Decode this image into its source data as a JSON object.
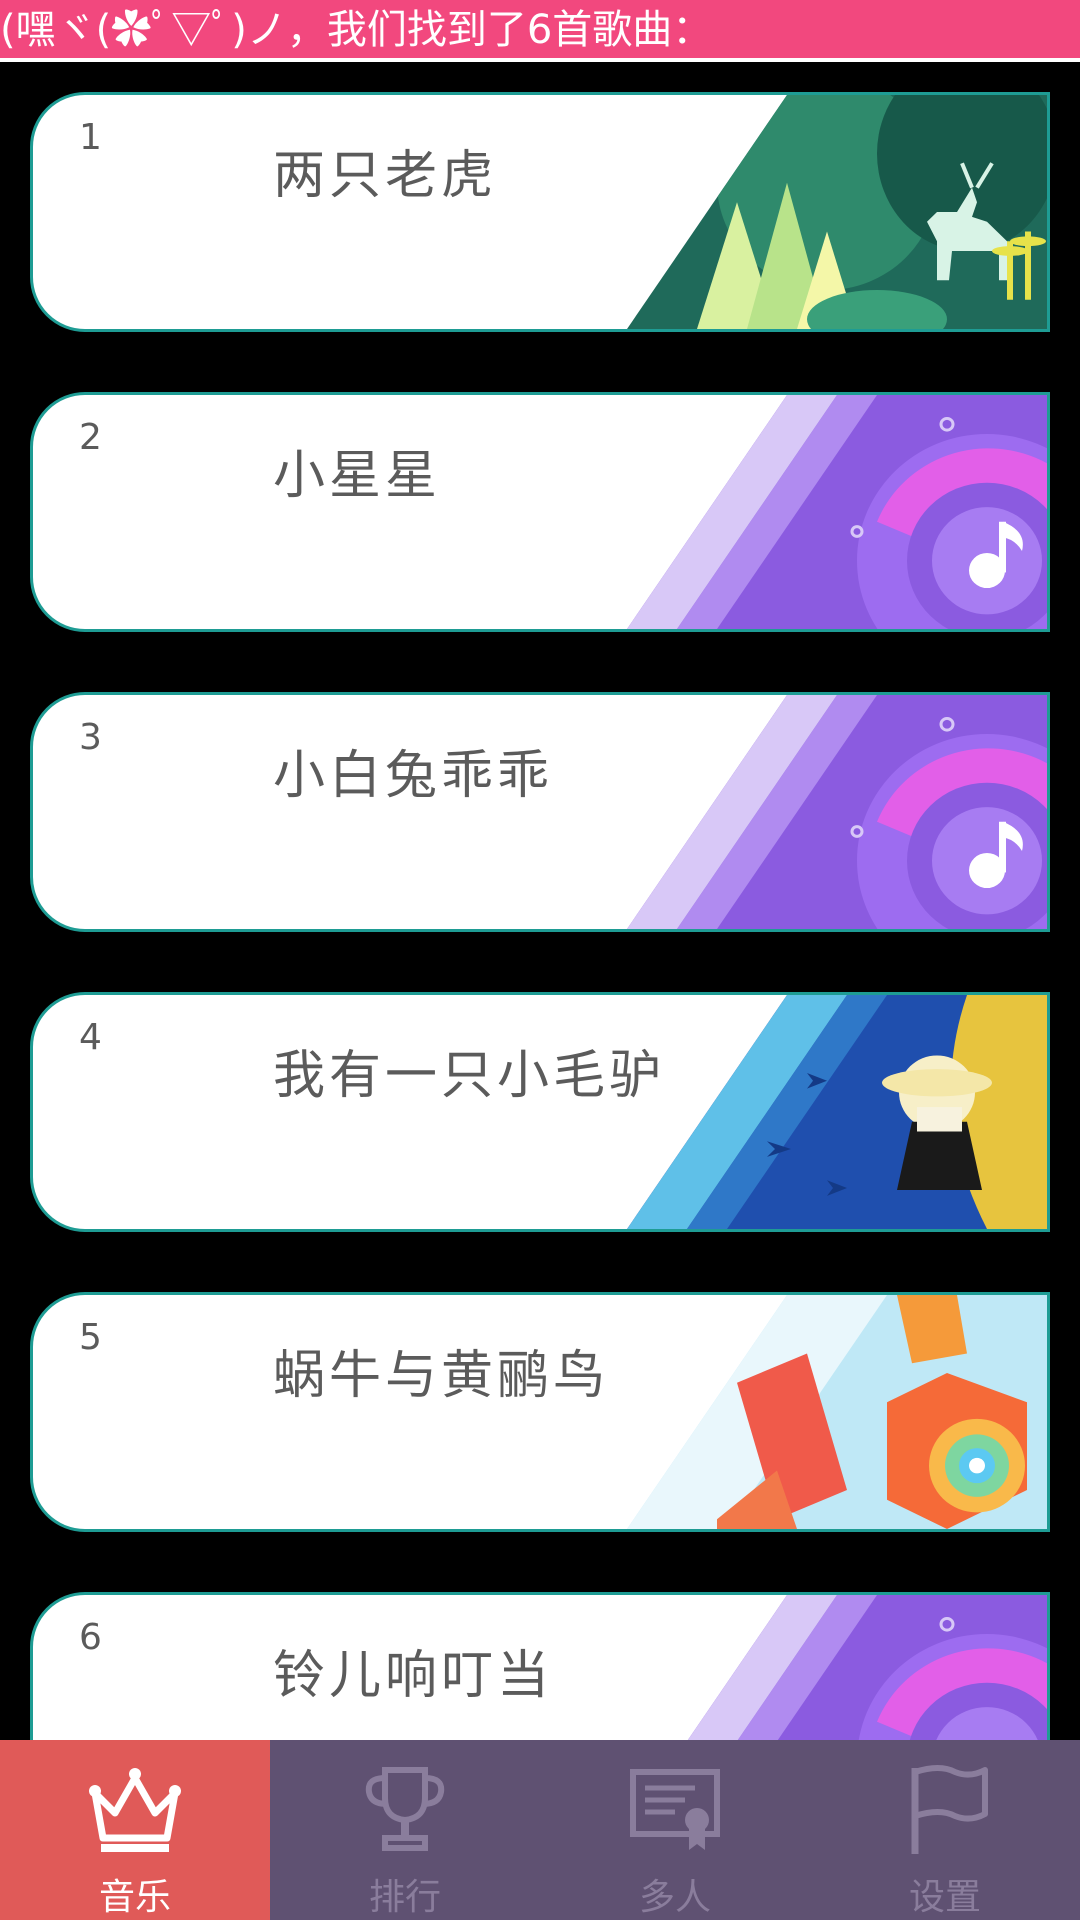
{
  "header": {
    "message": "(嘿ヾ(✿ﾟ▽ﾟ)ノ，我们找到了6首歌曲："
  },
  "songs": [
    {
      "number": "1",
      "title": "两只老虎",
      "art": "forest-deer-art"
    },
    {
      "number": "2",
      "title": "小星星",
      "art": "purple-music-art"
    },
    {
      "number": "3",
      "title": "小白兔乖乖",
      "art": "purple-music-art"
    },
    {
      "number": "4",
      "title": "我有一只小毛驴",
      "art": "girl-birds-art"
    },
    {
      "number": "5",
      "title": "蜗牛与黄鹂鸟",
      "art": "geometric-shapes-art"
    },
    {
      "number": "6",
      "title": "铃儿响叮当",
      "art": "purple-music-art"
    }
  ],
  "tabs": [
    {
      "label": "音乐",
      "icon": "crown-icon",
      "active": true
    },
    {
      "label": "排行",
      "icon": "trophy-icon",
      "active": false
    },
    {
      "label": "多人",
      "icon": "certificate-icon",
      "active": false
    },
    {
      "label": "设置",
      "icon": "flag-icon",
      "active": false
    }
  ],
  "colors": {
    "header_bg": "#f2487e",
    "card_border": "#1e9c94",
    "tabbar_bg": "#5f5172",
    "tab_active_bg": "#e05a58"
  }
}
